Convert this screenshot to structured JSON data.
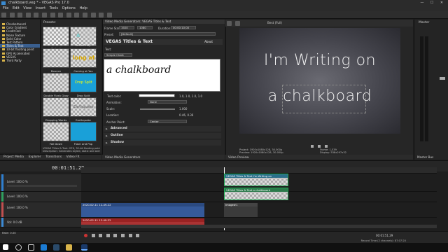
{
  "window": {
    "title": "chalkboard.veg * - VEGAS Pro 17.0",
    "minimize": "—",
    "maximize": "☐",
    "close": "✕"
  },
  "menu": [
    "File",
    "Edit",
    "View",
    "Insert",
    "Tools",
    "Options",
    "Help"
  ],
  "media_tree": {
    "items": [
      {
        "label": "Checkerboard",
        "selected": false
      },
      {
        "label": "Color Gradient",
        "selected": false
      },
      {
        "label": "Credit Roll",
        "selected": false
      },
      {
        "label": "Noise Texture",
        "selected": false
      },
      {
        "label": "Solid Color",
        "selected": false
      },
      {
        "label": "Test Pattern",
        "selected": false
      },
      {
        "label": "Titles & Text",
        "selected": true
      },
      {
        "label": "10-bit floating point",
        "selected": false
      },
      {
        "label": "GPU Accelerated",
        "selected": false
      },
      {
        "label": "VEGAS",
        "selected": false
      },
      {
        "label": "Third Party",
        "selected": false
      }
    ]
  },
  "presets": {
    "header": "Presets:",
    "items": [
      "Default",
      "Action Play",
      "Bounce",
      "Coming at You",
      "Double Flash Glow",
      "Drop Split",
      "Dropping Words",
      "Earthquake",
      "Fall Down",
      "Flash and Pop"
    ],
    "info": "VEGAS Titles & Text: OFX, 32-bit floating point, GPU Accelerated, Grouping VEGAS Generators, Version 1.0",
    "description": "Description: Generates styled, static and animated text and titles."
  },
  "left_tabs": [
    "Project Media",
    "Explorer",
    "Transitions",
    "Video FX"
  ],
  "generator": {
    "header": "Video Media Generators: VEGAS Titles & Text",
    "frame_size_label": "Frame Size:",
    "frame_w": "1920",
    "frame_h": "1080",
    "duration_label": "Duration:",
    "duration": "00:00:10;00",
    "preset_label": "Preset:",
    "preset_value": "[Default]",
    "plugin_name": "VEGAS Titles & Text",
    "about": "About",
    "text_label": "Text:",
    "font": "Simple Chalk",
    "text_value": "a chalkboard",
    "text_color_label": "Text color:",
    "text_color_values": "1.0, 1.0, 1.0, 1.0",
    "animation_label": "Animation:",
    "animation_value": "None",
    "scale_label": "Scale:",
    "scale_value": "1.000",
    "location_label": "Location:",
    "location_value": "0.46, 0.36",
    "anchor_label": "Anchor Point:",
    "anchor_value": "Center",
    "sections": [
      "Advanced",
      "Outline",
      "Shadow"
    ],
    "tab": "Video Media Generators"
  },
  "preview": {
    "quality": "Best (Full)",
    "line1": "I'm Writing on",
    "line2": "a chalkboard",
    "project_label": "Project:",
    "project": "1920x1080x128, 30.000p",
    "preview_label": "Preview:",
    "preview_res": "1920x1080x128, 30.000p",
    "display_label": "Display:",
    "display": "538x297x32",
    "frame_label": "Frame:",
    "frame": "1,539",
    "tab": "Video Preview"
  },
  "master": {
    "title": "Master",
    "tab": "Master Bus"
  },
  "timeline": {
    "timecode": "00:01:51.29",
    "tracks": [
      {
        "label": "Level: 100.0 %"
      },
      {
        "label": "Level: 100.0 %"
      },
      {
        "label": "Level: 100.0 %"
      },
      {
        "label": "Vol: 0.0 dB"
      }
    ],
    "clips": {
      "title1": "VEGAS Titles & Text I'm Writing on",
      "title2": "VEGAS Titles & Text a chalkboard",
      "video_a": "2020-02-11 12-49-22",
      "image": "Image#1",
      "audio_a": "2020-02-11 12-49-22"
    },
    "rate": "Rate: 0.00",
    "end_tc": "00:01:51.29",
    "record_time": "Record Time (2 channels): 87:07:20"
  }
}
